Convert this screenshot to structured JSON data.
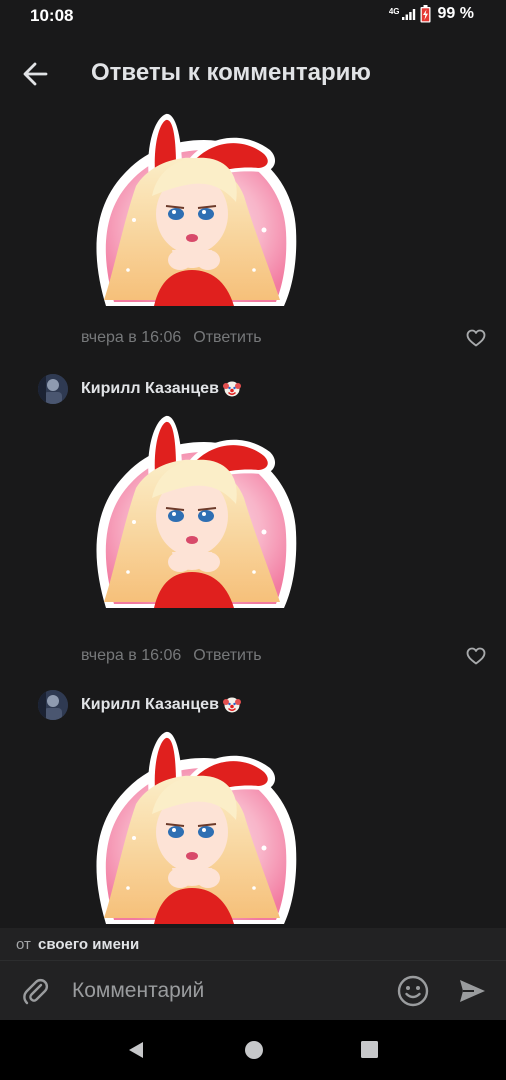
{
  "status_bar": {
    "time": "10:08",
    "network": "4G",
    "battery": "99 %"
  },
  "header": {
    "title": "Ответы к комментарию",
    "back_icon": "arrow-left-icon"
  },
  "comments": [
    {
      "date": "вчера в 16:06",
      "reply_label": "Ответить",
      "sticker": "bunny-girl-sticker"
    },
    {
      "author": "Кирилл Казанцев",
      "author_emoji": "clown-face",
      "date": "вчера в 16:06",
      "reply_label": "Ответить",
      "sticker": "bunny-girl-sticker"
    },
    {
      "author": "Кирилл Казанцев",
      "author_emoji": "clown-face",
      "sticker": "bunny-girl-sticker"
    }
  ],
  "sender": {
    "prefix": "от",
    "name": "своего имени"
  },
  "composer": {
    "placeholder": "Комментарий"
  },
  "colors": {
    "background": "#19191a",
    "text_primary": "#e1e3e6",
    "text_secondary": "#76787a",
    "sticker_red": "#e0201e"
  }
}
